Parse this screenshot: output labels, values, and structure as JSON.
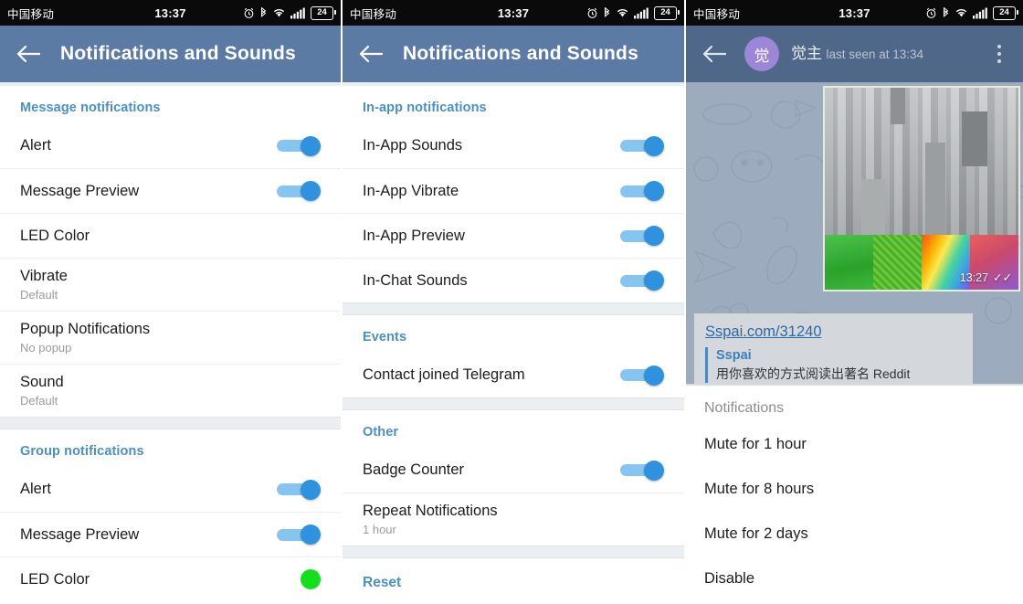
{
  "status_bar": {
    "carrier": "中国移动",
    "time": "13:37",
    "battery": "24",
    "icons": [
      "alarm-icon",
      "bluetooth-icon",
      "wifi-icon",
      "signal-icon",
      "battery-icon"
    ]
  },
  "panel1": {
    "title": "Notifications and Sounds",
    "back": "←",
    "sections": [
      {
        "header": "Message notifications",
        "rows": [
          {
            "title": "Alert",
            "sub": "",
            "control": "toggle",
            "on": true
          },
          {
            "title": "Message Preview",
            "sub": "",
            "control": "toggle",
            "on": true
          },
          {
            "title": "LED Color",
            "sub": "",
            "control": "none"
          },
          {
            "title": "Vibrate",
            "sub": "Default",
            "control": "none"
          },
          {
            "title": "Popup Notifications",
            "sub": "No popup",
            "control": "none"
          },
          {
            "title": "Sound",
            "sub": "Default",
            "control": "none"
          }
        ]
      },
      {
        "header": "Group notifications",
        "rows": [
          {
            "title": "Alert",
            "sub": "",
            "control": "toggle",
            "on": true
          },
          {
            "title": "Message Preview",
            "sub": "",
            "control": "toggle",
            "on": true
          },
          {
            "title": "LED Color",
            "sub": "",
            "control": "led",
            "color": "#12e01d"
          }
        ]
      }
    ]
  },
  "panel2": {
    "title": "Notifications and Sounds",
    "back": "←",
    "sections": [
      {
        "header": "In-app notifications",
        "rows": [
          {
            "title": "In-App Sounds",
            "sub": "",
            "control": "toggle",
            "on": true
          },
          {
            "title": "In-App Vibrate",
            "sub": "",
            "control": "toggle",
            "on": true
          },
          {
            "title": "In-App Preview",
            "sub": "",
            "control": "toggle",
            "on": true
          },
          {
            "title": "In-Chat Sounds",
            "sub": "",
            "control": "toggle",
            "on": true
          }
        ]
      },
      {
        "header": "Events",
        "rows": [
          {
            "title": "Contact joined Telegram",
            "sub": "",
            "control": "toggle",
            "on": true
          }
        ]
      },
      {
        "header": "Other",
        "rows": [
          {
            "title": "Badge Counter",
            "sub": "",
            "control": "toggle",
            "on": true
          },
          {
            "title": "Repeat Notifications",
            "sub": "1 hour",
            "control": "none"
          }
        ]
      }
    ],
    "reset_label": "Reset"
  },
  "panel3": {
    "back": "←",
    "avatar_initial": "觉",
    "avatar_color": "#9d86d8",
    "contact_name": "觉主",
    "contact_status": "last seen at 13:34",
    "menu_icon": "kebab-menu-icon",
    "message": {
      "photo_time": "13:27",
      "photo_status": "✓✓"
    },
    "link_preview": {
      "url": "Sspai.com/31240",
      "site": "Sspai",
      "description": "用你喜欢的方式阅读出著名 Reddit"
    },
    "popup": {
      "title": "Notifications",
      "items": [
        "Mute for 1 hour",
        "Mute for 8 hours",
        "Mute for 2 days",
        "Disable"
      ]
    }
  },
  "theme": {
    "appbar": "#5b7ba4",
    "appbar_dim": "#4f6889",
    "accent_blue": "#4a90c4",
    "toggle_track": "#86c5f0",
    "toggle_thumb": "#2f92de",
    "led_green": "#12e01d",
    "statusbar": "#0a0a0a"
  }
}
